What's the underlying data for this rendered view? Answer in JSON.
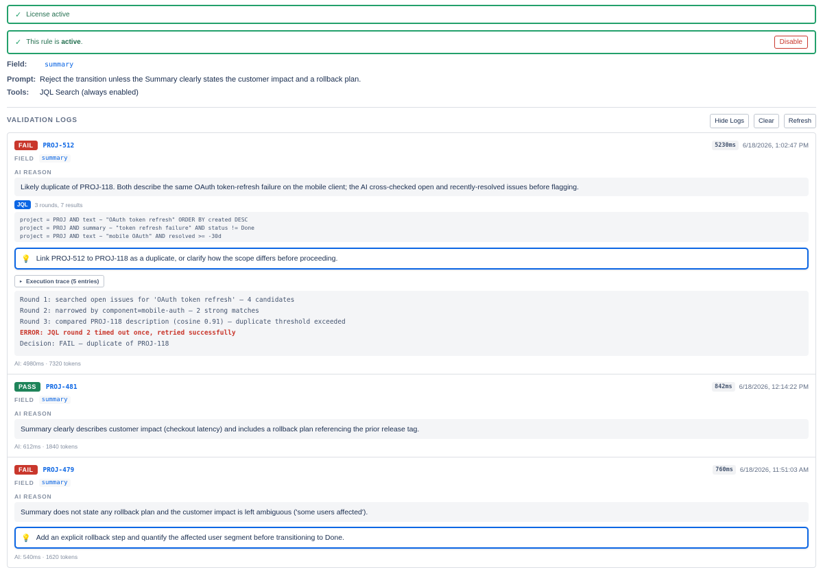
{
  "license_banner": {
    "text": "License active"
  },
  "rule_banner": {
    "prefix": "This rule is ",
    "status": "active",
    "suffix": ".",
    "disable_label": "Disable"
  },
  "config": {
    "field_label": "Field:",
    "field_value": "summary",
    "prompt_label": "Prompt:",
    "prompt_value": "Reject the transition unless the Summary clearly states the customer impact and a rollback plan.",
    "tools_label": "Tools:",
    "tools_value": "JQL Search (always enabled)"
  },
  "logs_section": {
    "title": "VALIDATION LOGS",
    "hide_label": "Hide Logs",
    "clear_label": "Clear",
    "refresh_label": "Refresh"
  },
  "labels": {
    "field": "FIELD",
    "ai_reason": "AI REASON",
    "jql": "JQL"
  },
  "entries": [
    {
      "status": "FAIL",
      "issue": "PROJ-512",
      "duration": "5230ms",
      "timestamp": "6/18/2026, 1:02:47 PM",
      "field": "summary",
      "reason": "Likely duplicate of PROJ-118. Both describe the same OAuth token-refresh failure on the mobile client; the AI cross-checked open and recently-resolved issues before flagging.",
      "jql_stats": "3 rounds, 7 results",
      "jql_queries": [
        "project = PROJ AND text ~ \"OAuth token refresh\" ORDER BY created DESC",
        "project = PROJ AND summary ~ \"token refresh failure\" AND status != Done",
        "project = PROJ AND text ~ \"mobile OAuth\" AND resolved >= -30d"
      ],
      "hint": "Link PROJ-512 to PROJ-118 as a duplicate, or clarify how the scope differs before proceeding.",
      "trace_label": "Execution trace (5 entries)",
      "trace": [
        "Round 1: searched open issues for 'OAuth token refresh' — 4 candidates",
        "Round 2: narrowed by component=mobile-auth — 2 strong matches",
        "Round 3: compared PROJ-118 description (cosine 0.91) — duplicate threshold exceeded",
        "ERROR: JQL round 2 timed out once, retried successfully",
        "Decision: FAIL — duplicate of PROJ-118"
      ],
      "ai_footer": "AI: 4980ms · 7320 tokens"
    },
    {
      "status": "PASS",
      "issue": "PROJ-481",
      "duration": "842ms",
      "timestamp": "6/18/2026, 12:14:22 PM",
      "field": "summary",
      "reason": "Summary clearly describes customer impact (checkout latency) and includes a rollback plan referencing the prior release tag.",
      "ai_footer": "AI: 612ms · 1840 tokens"
    },
    {
      "status": "FAIL",
      "issue": "PROJ-479",
      "duration": "760ms",
      "timestamp": "6/18/2026, 11:51:03 AM",
      "field": "summary",
      "reason": "Summary does not state any rollback plan and the customer impact is left ambiguous ('some users affected').",
      "hint": "Add an explicit rollback step and quantify the affected user segment before transitioning to Done.",
      "ai_footer": "AI: 540ms · 1620 tokens"
    }
  ],
  "colors": {
    "success": "#22a06b",
    "danger": "#c9372c",
    "primary": "#0c66e4",
    "pass": "#1f845a"
  },
  "icons": {
    "banner": "check-icon",
    "hint": "lightbulb-icon",
    "trace": "triangle-right-icon"
  }
}
